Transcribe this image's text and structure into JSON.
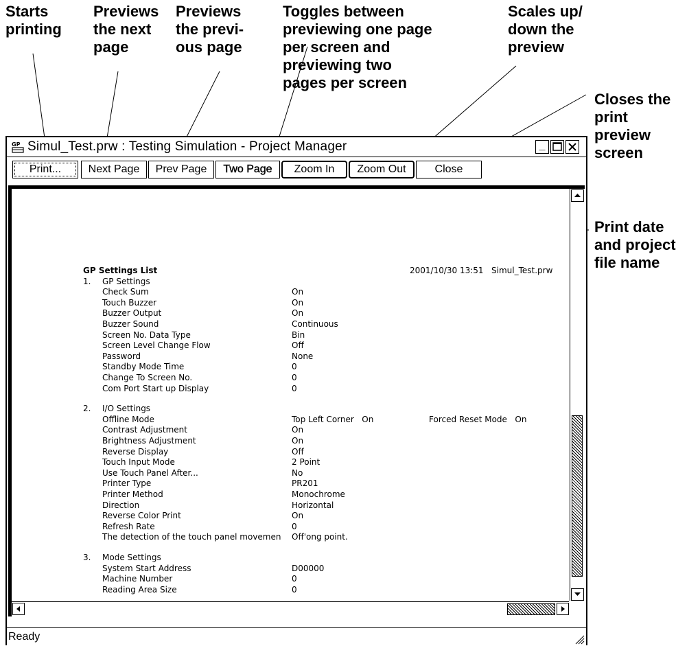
{
  "callouts": {
    "print": [
      "Starts",
      "printing"
    ],
    "next": [
      "Previews",
      "the next",
      "page"
    ],
    "prev": [
      "Previews",
      "the previ-",
      "ous page"
    ],
    "two": [
      "Toggles between",
      "previewing one page",
      "per screen and",
      "previewing two",
      "pages per screen"
    ],
    "zoom": [
      "Scales up/",
      "down the",
      "preview"
    ],
    "close": [
      "Closes the",
      "print",
      "preview",
      "screen"
    ],
    "printdate": [
      "Print date",
      "and project",
      "file name"
    ]
  },
  "window": {
    "title": "Simul_Test.prw : Testing Simulation - Project Manager",
    "minimize": "_",
    "status": "Ready"
  },
  "toolbar": {
    "print": "Print...",
    "next_page": "Next Page",
    "prev_page": "Prev Page",
    "two_page": "Two Page",
    "zoom_in": "Zoom In",
    "zoom_out": "Zoom Out",
    "close": "Close"
  },
  "document": {
    "heading": "GP Settings List",
    "print_date": "2001/10/30 13:51",
    "file_name": "Simul_Test.prw",
    "sections": [
      {
        "number": "1.",
        "title": "GP Settings",
        "rows": [
          {
            "label": "Check Sum",
            "value": "On"
          },
          {
            "label": "Touch Buzzer",
            "value": "On"
          },
          {
            "label": "Buzzer Output",
            "value": "On"
          },
          {
            "label": "Buzzer Sound",
            "value": "Continuous"
          },
          {
            "label": "Screen No. Data Type",
            "value": "Bin"
          },
          {
            "label": "Screen Level Change Flow",
            "value": "Off"
          },
          {
            "label": "Password",
            "value": "None"
          },
          {
            "label": "Standby Mode Time",
            "value": "0"
          },
          {
            "label": "Change To Screen No.",
            "value": "0"
          },
          {
            "label": "Com Port Start up Display",
            "value": "0"
          }
        ]
      },
      {
        "number": "2.",
        "title": "I/O Settings",
        "rows": [
          {
            "label": "Offline Mode",
            "value": "Top Left Corner   On",
            "extra": "Forced Reset Mode   On"
          },
          {
            "label": "Contrast Adjustment",
            "value": "On"
          },
          {
            "label": "Brightness Adjustment",
            "value": "On"
          },
          {
            "label": "Reverse Display",
            "value": "Off"
          },
          {
            "label": "Touch Input Mode",
            "value": "2 Point"
          },
          {
            "label": "Use Touch Panel After...",
            "value": "No"
          },
          {
            "label": "Printer Type",
            "value": "PR201"
          },
          {
            "label": "Printer Method",
            "value": "Monochrome"
          },
          {
            "label": "Direction",
            "value": "Horizontal"
          },
          {
            "label": "Reverse Color Print",
            "value": "On"
          },
          {
            "label": "Refresh Rate",
            "value": "0"
          },
          {
            "label": "The detection of the touch panel movemen",
            "value": "Off'ong point."
          }
        ]
      },
      {
        "number": "3.",
        "title": "Mode Settings",
        "rows": [
          {
            "label": "System Start Address",
            "value": "D00000"
          },
          {
            "label": "Machine Number",
            "value": "0"
          },
          {
            "label": "Reading Area Size",
            "value": "0"
          }
        ]
      }
    ]
  }
}
